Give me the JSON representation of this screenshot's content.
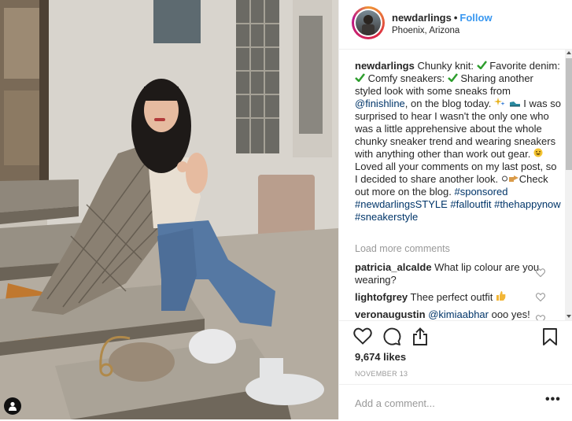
{
  "post": {
    "photo_alt": "",
    "user_tag_icon": "person-icon"
  },
  "header": {
    "username": "newdarlings",
    "separator": "•",
    "follow_label": "Follow",
    "location": "Phoenix, Arizona"
  },
  "caption": {
    "username": "newdarlings",
    "seg1": " Chunky knit: ",
    "seg2": " Favorite denim: ",
    "seg3": " Comfy sneakers: ",
    "seg4": " Sharing another styled look with some sneaks from ",
    "mention": "@finishline",
    "seg5": ", on the blog today. ",
    "seg6": " I was so surprised to hear I wasn't the only one who was a little apprehensive about the whole chunky sneaker trend and wearing sneakers with anything other than work out gear. ",
    "seg7": " Loved all your comments on my last post, so I decided to share another look. ",
    "seg8": "Check out more on the blog. ",
    "tag1": "#sponsored",
    "tag2": "#newdarlingsSTYLE",
    "tag3": "#falloutfit",
    "tag4": "#thehappynow",
    "tag5": "#sneakerstyle"
  },
  "load_more_label": "Load more comments",
  "comments": [
    {
      "username": "patricia_alcalde",
      "text": " What lip colour are you wearing?"
    },
    {
      "username": "lightofgrey",
      "text": " Thee perfect outfit "
    },
    {
      "username": "veronaugustin",
      "mention": "@kimiaabhar",
      "text": " ooo yes!"
    }
  ],
  "likes": "9,674 likes",
  "date": "NOVEMBER 13",
  "add_comment_placeholder": "Add a comment...",
  "more_label": "•••",
  "colors": {
    "link": "#3897f0",
    "mention": "#003569",
    "check": "#2e9e2e"
  }
}
